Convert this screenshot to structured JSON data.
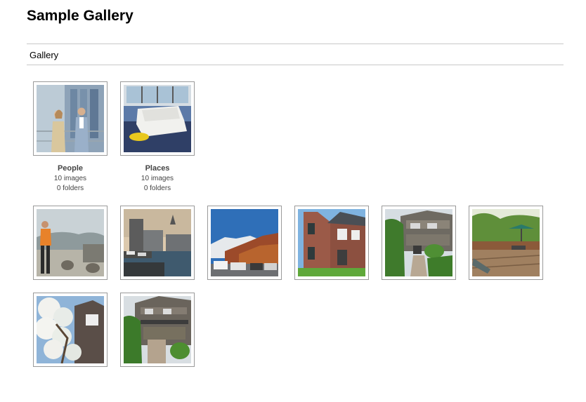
{
  "page": {
    "title": "Sample Gallery"
  },
  "breadcrumb": {
    "label": "Gallery"
  },
  "folders": [
    {
      "name": "People",
      "images": "10 images",
      "folders": "0 folders",
      "icon": "people-office-thumbnail"
    },
    {
      "name": "Places",
      "images": "10 images",
      "folders": "0 folders",
      "icon": "sofa-room-thumbnail"
    }
  ],
  "images": [
    {
      "subject": "woman-at-waterfront"
    },
    {
      "subject": "harbor-town"
    },
    {
      "subject": "mountain-parking-lot"
    },
    {
      "subject": "brick-house"
    },
    {
      "subject": "house-with-garden-steps"
    },
    {
      "subject": "wooden-deck-patio"
    },
    {
      "subject": "blossoming-tree-house"
    },
    {
      "subject": "house-with-balcony"
    }
  ]
}
